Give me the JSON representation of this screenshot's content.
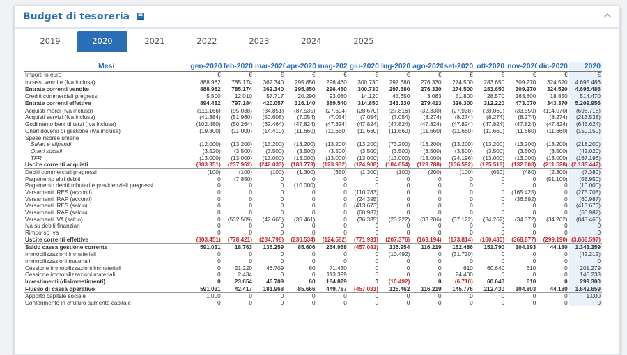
{
  "header": {
    "title": "Budget di tesoreria"
  },
  "tabs": [
    {
      "label": "2019",
      "active": false
    },
    {
      "label": "2020",
      "active": true
    },
    {
      "label": "2021",
      "active": false
    },
    {
      "label": "2022",
      "active": false
    },
    {
      "label": "2023",
      "active": false
    },
    {
      "label": "2024",
      "active": false
    },
    {
      "label": "2025",
      "active": false
    }
  ],
  "table": {
    "columns": [
      "Mesi",
      "gen-2020",
      "feb-2020",
      "mar-2020",
      "apr-2020",
      "mag-2020",
      "giu-2020",
      "lug-2020",
      "ago-2020",
      "set-2020",
      "ott-2020",
      "nov-2020",
      "dic-2020",
      "2020"
    ],
    "rows": [
      {
        "label": "Importi in euro",
        "values": [
          "€",
          "€",
          "€",
          "€",
          "€",
          "€",
          "€",
          "€",
          "€",
          "€",
          "€",
          "€",
          "€"
        ],
        "style": "bline"
      },
      {
        "label": "Incassi vendite (Iva inclusa)",
        "values": [
          "888.982",
          "785.174",
          "362.340",
          "295.850",
          "296.460",
          "300.730",
          "297.680",
          "276.330",
          "274.500",
          "283.650",
          "309.270",
          "324.520",
          "4.695.486"
        ]
      },
      {
        "label": "Entrate correnti vendite",
        "values": [
          "888.982",
          "785.174",
          "362.340",
          "295.850",
          "296.460",
          "300.730",
          "297.680",
          "276.330",
          "274.500",
          "283.650",
          "309.270",
          "324.520",
          "4.695.486"
        ],
        "style": "bold bline"
      },
      {
        "label": "Crediti commerciali pregressi",
        "values": [
          "5.500",
          "12.010",
          "57.717",
          "20.290",
          "93.080",
          "14.120",
          "45.650",
          "3.083",
          "51.800",
          "28.570",
          "163.800",
          "18.850",
          "514.470"
        ]
      },
      {
        "label": "Entrate correnti effettive",
        "values": [
          "894.482",
          "797.184",
          "420.057",
          "316.140",
          "389.540",
          "314.850",
          "343.330",
          "279.413",
          "326.300",
          "312.220",
          "473.070",
          "343.370",
          "5.209.956"
        ],
        "style": "bold bline"
      },
      {
        "label": "Acquisti merci (Iva inclusa)",
        "values": [
          "(111.166)",
          "(95.038)",
          "(84.851)",
          "(87.535)",
          "(27.694)",
          "(28.670)",
          "(27.816)",
          "(32.330)",
          "(27.938)",
          "(28.060)",
          "(33.550)",
          "(114.070)",
          "(698.718)"
        ]
      },
      {
        "label": "Acquisti servizi (Iva inclusa)",
        "values": [
          "(41.384)",
          "(51.960)",
          "(50.608)",
          "(7.054)",
          "(7.054)",
          "(7.054)",
          "(7.054)",
          "(8.274)",
          "(8.274)",
          "(8.274)",
          "(8.274)",
          "(8.274)",
          "(213.538)"
        ]
      },
      {
        "label": "Godimento beni di terzi (Iva inclusa)",
        "values": [
          "(102.480)",
          "(50.264)",
          "(62.464)",
          "(47.824)",
          "(47.824)",
          "(47.824)",
          "(47.824)",
          "(47.824)",
          "(47.824)",
          "(47.824)",
          "(47.824)",
          "(47.824)",
          "(645.624)"
        ]
      },
      {
        "label": "Oneri doversi di gestione (Iva inclusa)",
        "values": [
          "(19.800)",
          "(11.000)",
          "(14.410)",
          "(11.660)",
          "(11.660)",
          "(11.660)",
          "(11.660)",
          "(11.660)",
          "(11.660)",
          "(11.660)",
          "(11.660)",
          "(11.660)",
          "(150.150)"
        ]
      },
      {
        "label": "Spese risorse umane",
        "values": [
          "",
          "",
          "",
          "",
          "",
          "",
          "",
          "",
          "",
          "",
          "",
          "",
          ""
        ]
      },
      {
        "label": "Salari e stipendi",
        "values": [
          "(12.000)",
          "(13.200)",
          "(13.200)",
          "(13.200)",
          "(13.200)",
          "(13.200)",
          "(73.200)",
          "(13.200)",
          "(13.200)",
          "(13.200)",
          "(13.200)",
          "(13.200)",
          "(218.200)"
        ],
        "style": "italic"
      },
      {
        "label": "Oneri sociali",
        "values": [
          "(3.520)",
          "(3.500)",
          "(3.500)",
          "(3.500)",
          "(3.500)",
          "(3.500)",
          "(3.500)",
          "(3.500)",
          "(3.500)",
          "(3.500)",
          "(3.500)",
          "(3.500)",
          "(42.020)"
        ],
        "style": "italic"
      },
      {
        "label": "TFR",
        "values": [
          "(13.000)",
          "(13.000)",
          "(13.000)",
          "(13.000)",
          "(13.000)",
          "(13.000)",
          "(13.000)",
          "(13.000)",
          "(24.196)",
          "(13.000)",
          "(13.000)",
          "(13.000)",
          "(167.196)"
        ],
        "style": "italic"
      },
      {
        "label": "Uscite correnti acquisti",
        "values": [
          "(303.351)",
          "(237.962)",
          "(242.033)",
          "(183.773)",
          "(123.932)",
          "(124.908)",
          "(184.054)",
          "(129.788)",
          "(136.592)",
          "(125.518)",
          "(132.008)",
          "(211.528)",
          "(2.135.447)"
        ],
        "style": "bold red bline"
      },
      {
        "label": "Debiti commerciali pregressi",
        "values": [
          "(100)",
          "(100)",
          "(100)",
          "(1.300)",
          "(650)",
          "(1.300)",
          "(100)",
          "(200)",
          "(100)",
          "(650)",
          "(480)",
          "(2.300)",
          "(7.380)"
        ]
      },
      {
        "label": "Pagamento altri debiti",
        "values": [
          "0",
          "(7.850)",
          "0",
          "0",
          "0",
          "0",
          "0",
          "0",
          "0",
          "0",
          "0",
          "(51.100)",
          "(58.950)"
        ]
      },
      {
        "label": "Pagamento debiti tributari e previdenziali pregressi",
        "values": [
          "0",
          "0",
          "0",
          "(10.000)",
          "0",
          "0",
          "0",
          "0",
          "0",
          "0",
          "0",
          "0",
          "(10.000)"
        ]
      },
      {
        "label": "Versamenti IRES (acconti)",
        "values": [
          "0",
          "0",
          "0",
          "0",
          "0",
          "(110.283)",
          "0",
          "0",
          "0",
          "0",
          "(165.425)",
          "0",
          "(275.708)"
        ]
      },
      {
        "label": "Versamenti IRAP (acconti)",
        "values": [
          "0",
          "0",
          "0",
          "0",
          "0",
          "(24.395)",
          "0",
          "0",
          "0",
          "0",
          "(36.592)",
          "0",
          "(60.987)"
        ]
      },
      {
        "label": "Versamenti IRES (saldo)",
        "values": [
          "0",
          "0",
          "0",
          "0",
          "0",
          "(413.673)",
          "0",
          "0",
          "0",
          "0",
          "0",
          "0",
          "(413.673)"
        ]
      },
      {
        "label": "Versamenti IRAP (saldo)",
        "values": [
          "0",
          "0",
          "0",
          "0",
          "0",
          "(60.987)",
          "0",
          "0",
          "0",
          "0",
          "0",
          "0",
          "(60.987)"
        ]
      },
      {
        "label": "Versamenti IVA (saldo)",
        "values": [
          "0",
          "(532.509)",
          "(42.665)",
          "(35.461)",
          "0",
          "(36.385)",
          "(23.222)",
          "(33.206)",
          "(37.122)",
          "(34.262)",
          "(34.372)",
          "(34.262)",
          "(843.466)"
        ]
      },
      {
        "label": "Iva su debiti finanziari",
        "values": [
          "0",
          "0",
          "0",
          "0",
          "0",
          "0",
          "0",
          "0",
          "0",
          "0",
          "0",
          "0",
          "0"
        ]
      },
      {
        "label": "Rimborso Iva",
        "values": [
          "0",
          "0",
          "0",
          "0",
          "0",
          "0",
          "0",
          "0",
          "0",
          "0",
          "0",
          "0",
          "0"
        ]
      },
      {
        "label": "Uscite correnti effettive",
        "values": [
          "(303.451)",
          "(778.421)",
          "(284.798)",
          "(230.534)",
          "(124.582)",
          "(771.931)",
          "(207.376)",
          "(163.194)",
          "(173.814)",
          "(160.430)",
          "(368.877)",
          "(299.190)",
          "(3.866.597)"
        ],
        "style": "bold red bline"
      },
      {
        "label": "Saldo cassa gestione corrente",
        "values": [
          "591.031",
          "18.763",
          "135.259",
          "85.606",
          "264.958",
          "(457.081)",
          "135.954",
          "116.219",
          "152.486",
          "151.790",
          "104.193",
          "44.180",
          "1.343.359"
        ],
        "style": "bold bline",
        "redcells": [
          5
        ]
      },
      {
        "label": "Immobilizzazioni immateriali",
        "values": [
          "0",
          "0",
          "0",
          "0",
          "0",
          "0",
          "(10.492)",
          "0",
          "(31.720)",
          "0",
          "0",
          "0",
          "(42.212)"
        ]
      },
      {
        "label": "Immobilizzazioni materiali",
        "values": [
          "0",
          "0",
          "0",
          "0",
          "0",
          "0",
          "0",
          "0",
          "0",
          "0",
          "0",
          "0",
          "0"
        ]
      },
      {
        "label": "Cessione immobilizzazioni immateriali",
        "values": [
          "0",
          "21.220",
          "46.709",
          "60",
          "71.430",
          "0",
          "0",
          "0",
          "610",
          "60.640",
          "610",
          "0",
          "201.279"
        ]
      },
      {
        "label": "Cessione immobilizzazioni materiali",
        "values": [
          "0",
          "2.434",
          "0",
          "0",
          "113.399",
          "0",
          "0",
          "0",
          "24.400",
          "0",
          "0",
          "0",
          "140.233"
        ]
      },
      {
        "label": "Investimenti (disinvestimenti)",
        "values": [
          "0",
          "23.654",
          "46.709",
          "60",
          "184.829",
          "0",
          "(10.492)",
          "0",
          "(6.710)",
          "60.640",
          "610",
          "0",
          "299.300"
        ],
        "style": "bold bline",
        "redcells": [
          6,
          8
        ]
      },
      {
        "label": "Flusso di cassa operativo",
        "values": [
          "591.031",
          "42.417",
          "181.968",
          "85.666",
          "449.787",
          "(457.081)",
          "125.462",
          "116.219",
          "145.776",
          "212.430",
          "104.803",
          "44.180",
          "1.642.659"
        ],
        "style": "bold bline",
        "redcells": [
          5
        ]
      },
      {
        "label": "Apporto capitale sociale",
        "values": [
          "1.000",
          "0",
          "0",
          "0",
          "0",
          "0",
          "0",
          "0",
          "0",
          "0",
          "0",
          "0",
          "1.000"
        ]
      },
      {
        "label": "Conferimento in c/futuro aumento capitale",
        "values": [
          "0",
          "0",
          "0",
          "0",
          "0",
          "0",
          "0",
          "0",
          "0",
          "0",
          "0",
          "0",
          "0"
        ]
      }
    ]
  }
}
